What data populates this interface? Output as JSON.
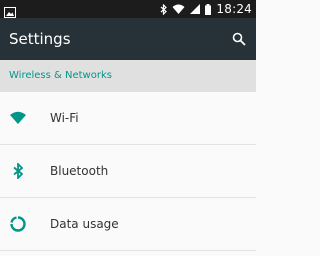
{
  "status_bar": {
    "time": "18:24",
    "icons": [
      "image-icon",
      "bluetooth-icon",
      "wifi-icon",
      "signal-icon",
      "battery-icon"
    ]
  },
  "app_bar": {
    "title": "Settings",
    "search_icon": "search-icon"
  },
  "section": {
    "label": "Wireless & Networks"
  },
  "items": [
    {
      "label": "Wi-Fi",
      "icon": "wifi-icon"
    },
    {
      "label": "Bluetooth",
      "icon": "bluetooth-icon"
    },
    {
      "label": "Data usage",
      "icon": "data-usage-icon"
    }
  ],
  "colors": {
    "accent": "#009688",
    "app_bar": "#263238",
    "status_bar": "#1c1c1c",
    "section_bg": "#e0e0e0"
  }
}
